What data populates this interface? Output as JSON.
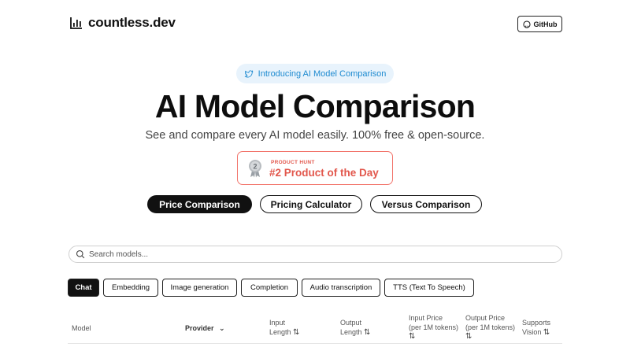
{
  "brand": {
    "name": "countless.dev",
    "logo_icon": "bar-chart-icon"
  },
  "header": {
    "github_label": "GitHub",
    "github_icon": "github-icon"
  },
  "announcement": {
    "label": "Introducing AI Model Comparison",
    "icon": "twitter-icon",
    "color": "#1d8ad0"
  },
  "hero": {
    "title": "AI Model Comparison",
    "subtitle": "See and compare every AI model easily. 100% free & open-source."
  },
  "product_hunt": {
    "small": "PRODUCT HUNT",
    "big": "#2 Product of the Day",
    "icon": "medal-icon",
    "color": "#e2574c"
  },
  "nav_pills": [
    {
      "label": "Price Comparison",
      "active": true
    },
    {
      "label": "Pricing Calculator",
      "active": false
    },
    {
      "label": "Versus Comparison",
      "active": false
    }
  ],
  "search": {
    "placeholder": "Search models...",
    "value": "",
    "icon": "search-icon"
  },
  "tabs": [
    {
      "label": "Chat",
      "active": true
    },
    {
      "label": "Embedding",
      "active": false
    },
    {
      "label": "Image generation",
      "active": false
    },
    {
      "label": "Completion",
      "active": false
    },
    {
      "label": "Audio transcription",
      "active": false
    },
    {
      "label": "TTS (Text To Speech)",
      "active": false
    }
  ],
  "table": {
    "headers": {
      "model": "Model",
      "provider": "Provider",
      "input_length": [
        "Input",
        "Length"
      ],
      "output_length": [
        "Output",
        "Length"
      ],
      "input_price": [
        "Input Price",
        "(per 1M tokens)"
      ],
      "output_price": [
        "Output Price",
        "(per 1M tokens)"
      ],
      "vision": [
        "Supports",
        "Vision"
      ]
    },
    "sort_glyph": "⇅",
    "dropdown_glyph": "⌄"
  }
}
